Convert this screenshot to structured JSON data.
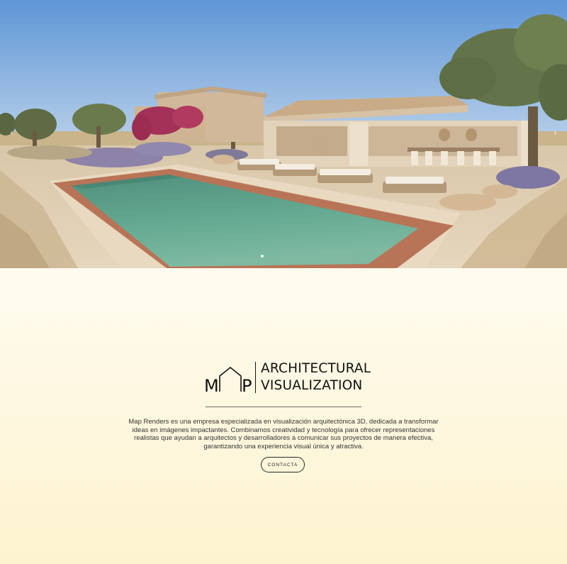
{
  "hero": {
    "arrow_left": "‹",
    "arrow_right": "›",
    "slides_shown": 1
  },
  "brand": {
    "logo_letters": "MAP",
    "line1": "ARCHITECTURAL",
    "line2": "VISUALIZATION"
  },
  "about": {
    "text": "Map Renders es una empresa especializada en visualización arquitectónica 3D, dedicada a transformar ideas en imágenes impactantes. Combinamos creatividad y tecnología para ofrecer representaciones realistas que ayudan a arquitectos y desarrolladores a comunicar sus proyectos de manera efectiva, garantizando una experiencia visual única y atractiva."
  },
  "cta": {
    "label": "CONTACTA"
  },
  "colors": {
    "sky": "#6d9fd8",
    "pool_water": "#5aa58e",
    "pool_coping": "#b87456",
    "stone": "#d8c6aa",
    "bougainvillea": "#a33158",
    "olive": "#6b7a4b",
    "text": "#111111",
    "background_bottom": "#fdf3cf"
  }
}
